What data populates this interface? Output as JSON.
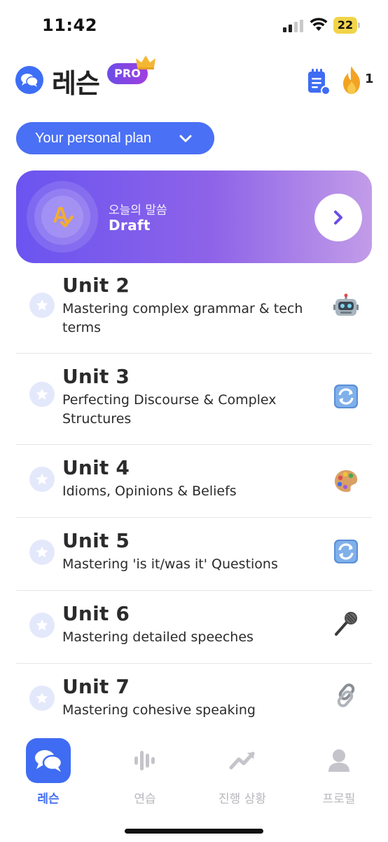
{
  "status_bar": {
    "time": "11:42",
    "battery": "22"
  },
  "header": {
    "title": "레슨",
    "pro_badge": "PRO",
    "streak_count": "1"
  },
  "plan_selector": {
    "label": "Your personal plan"
  },
  "daily_card": {
    "subtitle": "오늘의 말씀",
    "title": "Draft"
  },
  "units": [
    {
      "title": "Unit 2",
      "description": "Mastering complex grammar & tech terms",
      "emoji": "robot"
    },
    {
      "title": "Unit 3",
      "description": "Perfecting Discourse & Complex Structures",
      "emoji": "repeat"
    },
    {
      "title": "Unit 4",
      "description": "Idioms, Opinions & Beliefs",
      "emoji": "palette"
    },
    {
      "title": "Unit 5",
      "description": "Mastering 'is it/was it' Questions",
      "emoji": "repeat"
    },
    {
      "title": "Unit 6",
      "description": "Mastering detailed speeches",
      "emoji": "microphone"
    },
    {
      "title": "Unit 7",
      "description": "Mastering cohesive speaking",
      "emoji": "link"
    }
  ],
  "tabs": [
    {
      "label": "레슨",
      "icon": "chat-bubbles-icon",
      "active": true
    },
    {
      "label": "연습",
      "icon": "waveform-icon",
      "active": false
    },
    {
      "label": "진행 상황",
      "icon": "trending-up-icon",
      "active": false
    },
    {
      "label": "프로필",
      "icon": "person-icon",
      "active": false
    }
  ],
  "colors": {
    "primary": "#3f6cf2",
    "card_gradient_start": "#6a54f0",
    "card_gradient_end": "#c29ce8"
  }
}
